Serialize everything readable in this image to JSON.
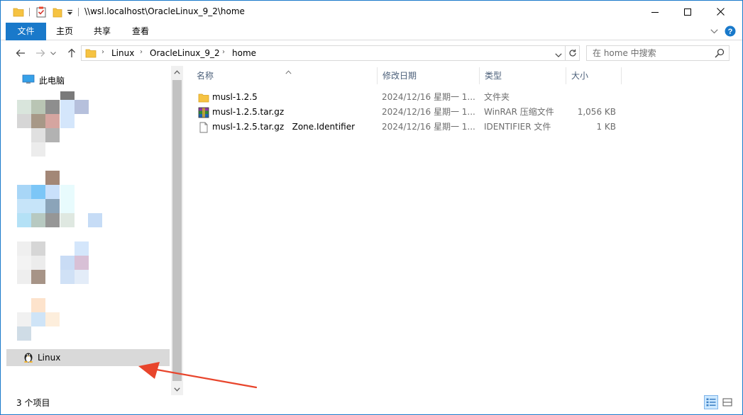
{
  "window": {
    "title": "\\\\wsl.localhost\\OracleLinux_9_2\\home"
  },
  "ribbon": {
    "tabs": [
      {
        "label": "文件",
        "active": true
      },
      {
        "label": "主页",
        "active": false
      },
      {
        "label": "共享",
        "active": false
      },
      {
        "label": "查看",
        "active": false
      }
    ],
    "expand_icon": "chevron-down-icon",
    "help_icon": "help-icon"
  },
  "address": {
    "breadcrumbs": [
      "Linux",
      "OracleLinux_9_2",
      "home"
    ],
    "search_placeholder": "在 home 中搜索"
  },
  "navigation": {
    "this_pc_label": "此电脑",
    "linux_label": "Linux"
  },
  "columns": {
    "name": "名称",
    "date": "修改日期",
    "type": "类型",
    "size": "大小"
  },
  "files": [
    {
      "name": "musl-1.2.5",
      "date": "2024/12/16 星期一 1...",
      "type": "文件夹",
      "size": "",
      "icon": "folder-icon"
    },
    {
      "name": "musl-1.2.5.tar.gz",
      "date": "2024/12/16 星期一 1...",
      "type": "WinRAR 压缩文件",
      "size": "1,056 KB",
      "icon": "winrar-archive-icon"
    },
    {
      "name": "musl-1.2.5.tar.gz   Zone.Identifier",
      "date": "2024/12/16 星期一 1...",
      "type": "IDENTIFIER 文件",
      "size": "1 KB",
      "icon": "blank-file-icon"
    }
  ],
  "status": {
    "item_count": "3 个项目"
  },
  "colors": {
    "accent": "#1979ca",
    "selection": "#d9d9d9",
    "folder": "#f6c342",
    "annotation": "#e8452c"
  }
}
